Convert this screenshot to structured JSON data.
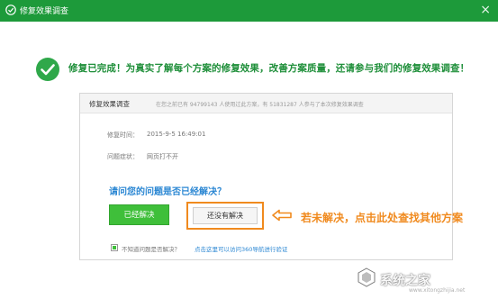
{
  "window": {
    "title": "修复效果调查",
    "close_label": "×"
  },
  "headline": "修复已完成！为真实了解每个方案的修复效果，改善方案质量，还请参与我们的修复效果调查！",
  "survey": {
    "header_title": "修复效果调查",
    "stats_text": "在您之前已有 94799143 人使用过此方案，有 51831287 人参与了本次修复效果调查",
    "fix_time_label": "修复时间：",
    "fix_time_value": "2015-9-5 16:49:01",
    "symptom_label": "问题症状：",
    "symptom_value": "网页打不开",
    "question": "请问您的问题是否已经解决？",
    "solved_button": "已经解决",
    "unsolved_button": "还没有解决",
    "checkbox_label": "不知道问题是否解决？",
    "help_link": "点击这里可以访问360导航进行验证",
    "checkbox_checked": true
  },
  "annotation": {
    "text": "若未解决，点击此处查找其他方案",
    "color": "#f08a1e"
  },
  "watermark": {
    "text": "系统之家",
    "url": "www.xitongzhijia.net"
  },
  "colors": {
    "titlebar": "#1d9a3a",
    "success_green": "#1f8f3a",
    "primary_button": "#3fbf3a",
    "link_blue": "#2b87d3",
    "highlight_orange": "#f08a1e"
  }
}
